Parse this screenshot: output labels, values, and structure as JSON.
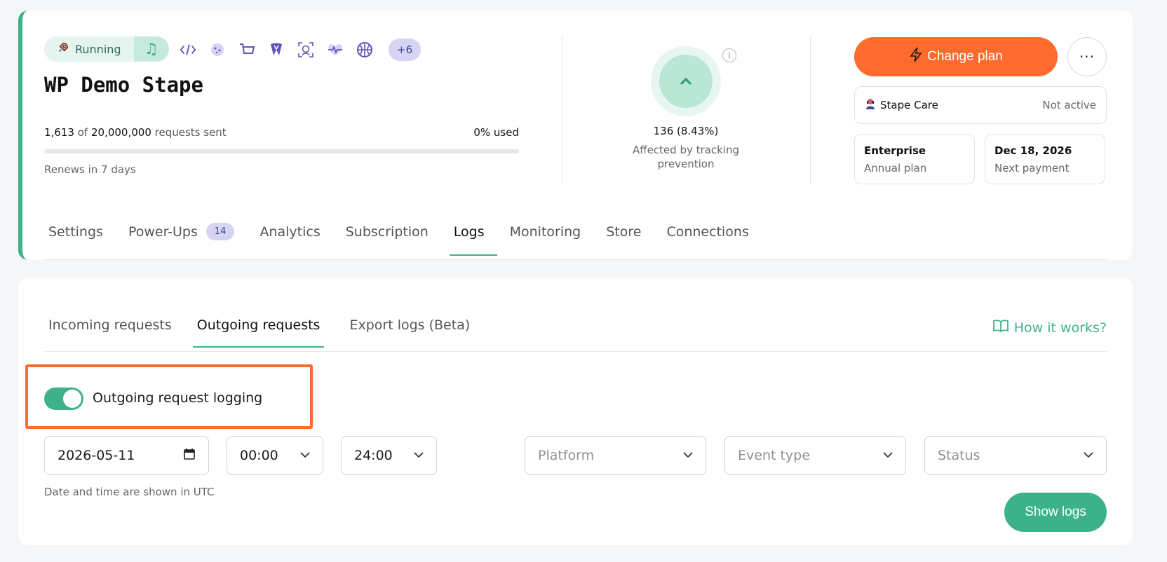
{
  "header": {
    "status_label": "Running",
    "more_integrations": "+6",
    "container_name": "WP Demo Stape",
    "requests_used": "1,613",
    "requests_of": "of",
    "requests_limit": "20,000,000",
    "requests_suffix": "requests sent",
    "used_percent_label": "0% used",
    "used_fraction": 0,
    "renews": "Renews in 7 days",
    "tracking_value": "136 (8.43%)",
    "tracking_label": "Affected by tracking prevention",
    "change_plan_label": "Change plan",
    "more_label": "···",
    "care_label": "Stape Care",
    "care_status": "Not active",
    "plan_name": "Enterprise",
    "plan_period": "Annual plan",
    "next_payment_date": "Dec 18, 2026",
    "next_payment_label": "Next payment"
  },
  "main_tabs": [
    {
      "label": "Settings"
    },
    {
      "label": "Power-Ups",
      "badge": "14"
    },
    {
      "label": "Analytics"
    },
    {
      "label": "Subscription"
    },
    {
      "label": "Logs",
      "active": true
    },
    {
      "label": "Monitoring"
    },
    {
      "label": "Store"
    },
    {
      "label": "Connections"
    }
  ],
  "logs": {
    "sub_tabs": [
      {
        "label": "Incoming requests"
      },
      {
        "label": "Outgoing requests",
        "active": true
      },
      {
        "label": "Export logs (Beta)"
      }
    ],
    "how_it_works": "How it works?",
    "toggle_label": "Outgoing request logging",
    "toggle_on": true,
    "date_value": "2026-05-11",
    "time_from": "00:00",
    "time_to": "24:00",
    "platform_placeholder": "Platform",
    "event_type_placeholder": "Event type",
    "status_placeholder": "Status",
    "utc_note": "Date and time are shown in UTC",
    "show_logs_label": "Show logs"
  },
  "colors": {
    "accent_green": "#3db28a",
    "accent_orange": "#ff6b2c",
    "badge_purple": "#d6d3f3"
  }
}
